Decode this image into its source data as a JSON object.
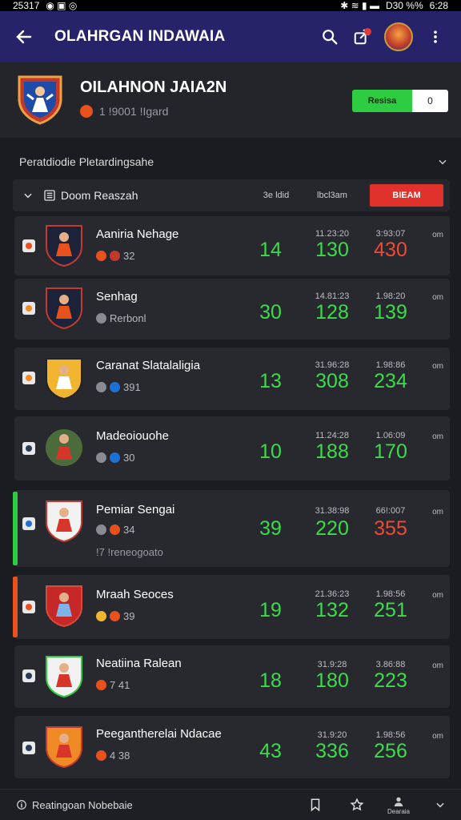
{
  "status": {
    "time": "25317",
    "right": "D30 %%",
    "clock": "6:28"
  },
  "app": {
    "title": "OLAHRGAN INDAWAIA"
  },
  "hero": {
    "title": "OILAHNON JAIA2N",
    "subtitle": "1 !9001 !Igard",
    "seg_left": "Resisa",
    "seg_right": "0"
  },
  "section": {
    "title": "Peratdiodie Pletardingsahe"
  },
  "list": {
    "label": "Doom Reaszah",
    "col1": "3e ldid",
    "col2": "lbcl3am",
    "action": "BIEAM"
  },
  "players": [
    {
      "name": "Aaniria Nehage",
      "meta": "32",
      "v1": "14",
      "s2": "11.23:20",
      "v2": "130",
      "s3": "3:93:07",
      "v3": "430",
      "v3_color": "red",
      "sx": "om",
      "check": "#e8501c"
    },
    {
      "name": "Senhag",
      "meta": "Rerbonl",
      "v1": "30",
      "s2": "14.81:23",
      "v2": "128",
      "s3": "1.98:20",
      "v3": "139",
      "v3_color": "green",
      "sx": "om",
      "check": "#f08a24"
    },
    {
      "name": "Caranat Slatalaligia",
      "meta": "391",
      "v1": "13",
      "s2": "31.96:28",
      "v2": "308",
      "s3": "1.98:86",
      "v3": "234",
      "v3_color": "green",
      "sx": "om",
      "check": "#f08a24"
    },
    {
      "name": "Madeoiouohe",
      "meta": "30",
      "v1": "10",
      "s2": "11.24:28",
      "v2": "188",
      "s3": "1.06:09",
      "v3": "170",
      "v3_color": "green",
      "sx": "om",
      "check": "#2b3b55"
    },
    {
      "name": "Pemiar Sengai",
      "meta": "34",
      "note": "!7 !reneogoato",
      "v1": "39",
      "s2": "31.38:98",
      "v2": "220",
      "s3": "66!:007",
      "v3": "355",
      "v3_color": "red",
      "sx": "om",
      "check": "#1e6fd6"
    },
    {
      "name": "Mraah Seoces",
      "meta": "39",
      "v1": "19",
      "s2": "21.36:23",
      "v2": "132",
      "s3": "1.98:56",
      "v3": "251",
      "v3_color": "green",
      "sx": "om",
      "check": "#e8501c"
    },
    {
      "name": "Neatiina Ralean",
      "meta": "7 41",
      "v1": "18",
      "s2": "31.9:28",
      "v2": "180",
      "s3": "3.86:88",
      "v3": "223",
      "v3_color": "green",
      "sx": "om",
      "check": "#2b3b55"
    },
    {
      "name": "Peegantherelai Ndacae",
      "meta": "4 38",
      "v1": "43",
      "s2": "31.9:20",
      "v2": "336",
      "s3": "1.98:56",
      "v3": "256",
      "v3_color": "green",
      "sx": "om",
      "check": "#2b3b55"
    }
  ],
  "bottom": {
    "label": "Reatingoan Nobebaie",
    "profile_label": "Dearaia"
  }
}
